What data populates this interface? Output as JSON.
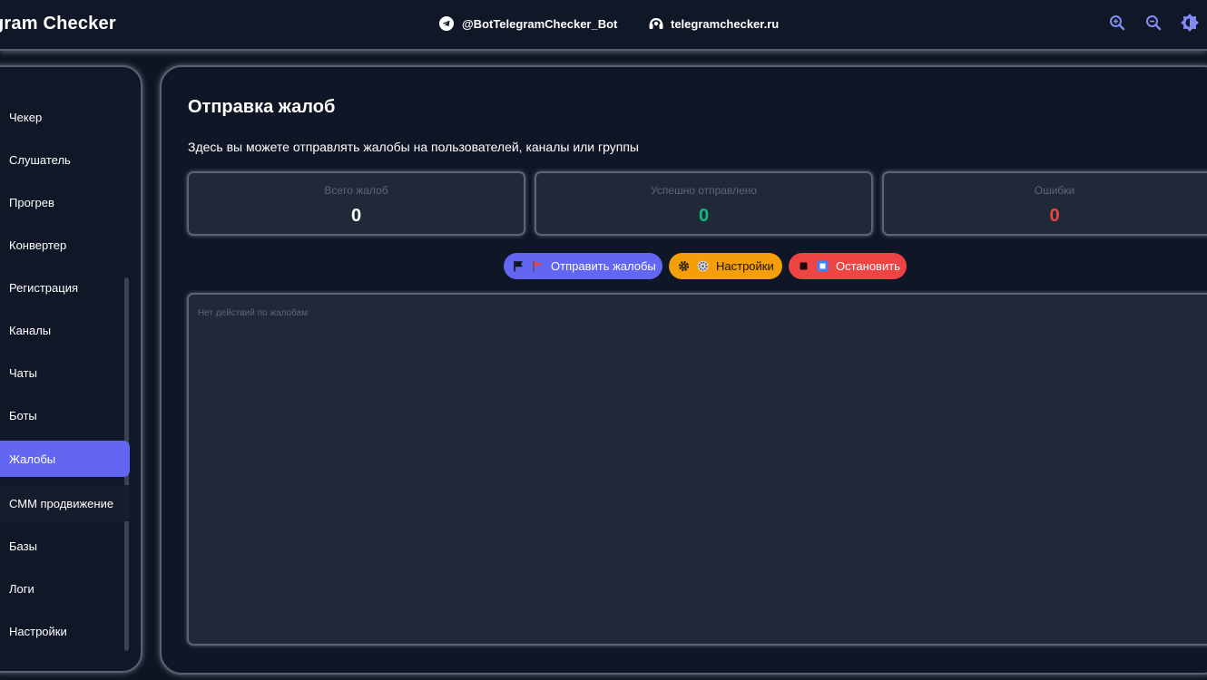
{
  "header": {
    "app_title": "gram Checker",
    "bot_link": "@BotTelegramChecker_Bot",
    "site_link": "telegramchecker.ru",
    "buttons": [
      "zoom-in",
      "zoom-out",
      "theme-toggle"
    ]
  },
  "sidebar": {
    "items": [
      {
        "label": "Чекер"
      },
      {
        "label": "Слушатель"
      },
      {
        "label": "Прогрев"
      },
      {
        "label": "Конвертер"
      },
      {
        "label": "Регистрация"
      },
      {
        "label": "Каналы"
      },
      {
        "label": "Чаты"
      },
      {
        "label": "Боты"
      },
      {
        "label": "Жалобы",
        "active": true
      },
      {
        "label": "СММ продвижение"
      },
      {
        "label": "Базы"
      },
      {
        "label": "Логи"
      },
      {
        "label": "Настройки"
      }
    ]
  },
  "main": {
    "title": "Отправка жалоб",
    "subtitle": "Здесь вы можете отправлять жалобы на пользователей, каналы или группы",
    "stats": {
      "total": {
        "label": "Всего жалоб",
        "value": "0"
      },
      "success": {
        "label": "Успешно отправлено",
        "value": "0"
      },
      "errors": {
        "label": "Ошибки",
        "value": "0"
      }
    },
    "actions": {
      "send": "Отправить жалобы",
      "settings": "Настройки",
      "stop": "Остановить"
    },
    "log_empty": "Нет действий по жалобам"
  },
  "colors": {
    "accent": "#6366f1",
    "warning": "#f59e0b",
    "danger": "#ef4444",
    "success": "#10b981",
    "background": "#0f1422",
    "card": "#1f2938"
  }
}
